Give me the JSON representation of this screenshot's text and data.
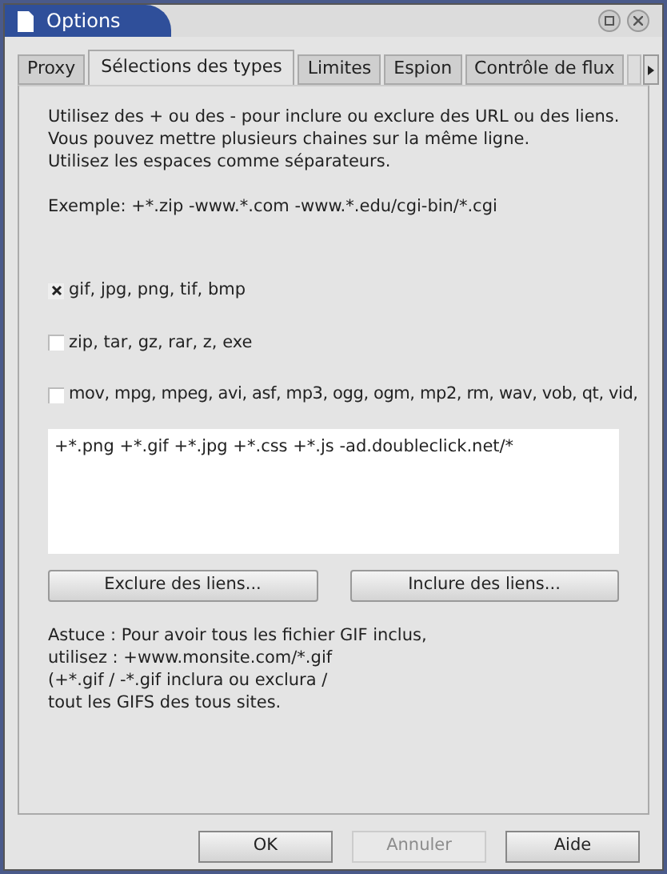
{
  "window": {
    "title": "Options"
  },
  "tabs": [
    {
      "label": "Proxy",
      "selected": false
    },
    {
      "label": "Sélections des types",
      "selected": true
    },
    {
      "label": "Limites",
      "selected": false
    },
    {
      "label": "Espion",
      "selected": false
    },
    {
      "label": "Contrôle de flux",
      "selected": false
    }
  ],
  "intro": [
    "Utilisez des + ou des - pour inclure ou exclure des URL ou des liens.",
    "Vous pouvez mettre plusieurs chaines sur la même ligne.",
    "Utilisez les espaces comme séparateurs."
  ],
  "example": "Exemple: +*.zip -www.*.com -www.*.edu/cgi-bin/*.cgi",
  "filetypes": [
    {
      "label": "gif, jpg, png, tif, bmp",
      "checked": true
    },
    {
      "label": "zip, tar, gz, rar, z, exe",
      "checked": false
    },
    {
      "label": "mov, mpg, mpeg, avi, asf, mp3, ogg, ogm, mp2, rm, wav, vob, qt, vid,",
      "checked": false
    }
  ],
  "filter_text": "+*.png +*.gif +*.jpg +*.css +*.js -ad.doubleclick.net/*",
  "link_buttons": [
    "Exclure des liens...",
    "Inclure des liens..."
  ],
  "tip": [
    "Astuce : Pour avoir tous les fichier GIF inclus,",
    "utilisez : +www.monsite.com/*.gif",
    "(+*.gif / -*.gif inclura ou exclura /",
    "tout les GIFS des tous sites."
  ],
  "buttons": [
    {
      "label": "OK",
      "disabled": false
    },
    {
      "label": "Annuler",
      "disabled": true
    },
    {
      "label": "Aide",
      "disabled": false
    }
  ]
}
